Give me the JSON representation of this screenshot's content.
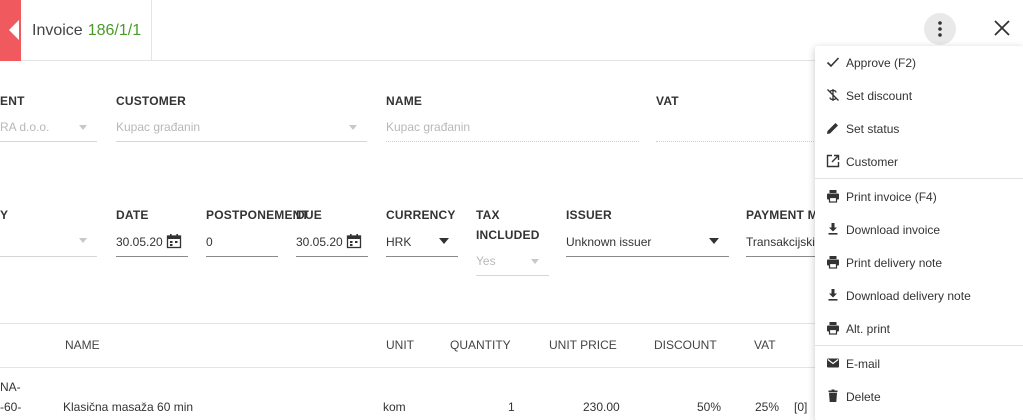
{
  "header": {
    "title_prefix": "Invoice",
    "title_number": "186/1/1"
  },
  "row1": {
    "partial_label": "ENT",
    "partial_value": "RA d.o.o.",
    "customer_label": "CUSTOMER",
    "customer_value": "Kupac građanin",
    "name_label": "NAME",
    "name_value": "Kupac građanin",
    "vat_label": "VAT"
  },
  "row2": {
    "partial_label": "Y",
    "date_label": "DATE",
    "date_value": "30.05.20",
    "postponement_label": "POSTPONEMENT",
    "postponement_value": "0",
    "due_label": "DUE",
    "due_value": "30.05.20",
    "currency_label": "CURRENCY",
    "currency_value": "HRK",
    "tax_label_1": "TAX",
    "tax_label_2": "INCLUDED",
    "tax_value": "Yes",
    "issuer_label": "ISSUER",
    "issuer_value": "Unknown issuer",
    "payment_label": "PAYMENT M",
    "payment_value": "Transakcijski"
  },
  "table": {
    "headers": {
      "name": "NAME",
      "unit": "UNIT",
      "quantity": "QUANTITY",
      "unit_price": "UNIT PRICE",
      "discount": "DISCOUNT",
      "vat": "VAT"
    },
    "row": {
      "code_line1": "NA-",
      "code_line2": "-60-",
      "name": "Klasična masaža 60 min",
      "unit": "kom",
      "quantity": "1",
      "unit_price": "230.00",
      "discount": "50%",
      "vat": "25%",
      "extra": "[0]"
    }
  },
  "menu": {
    "items": [
      {
        "label": "Approve (F2)",
        "icon": "check-icon"
      },
      {
        "label": "Set discount",
        "icon": "discount-off-icon"
      },
      {
        "label": "Set status",
        "icon": "pencil-icon"
      },
      {
        "label": "Customer",
        "icon": "open-external-icon"
      },
      {
        "label": "Print invoice (F4)",
        "icon": "printer-icon"
      },
      {
        "label": "Download invoice",
        "icon": "download-icon"
      },
      {
        "label": "Print delivery note",
        "icon": "printer-icon"
      },
      {
        "label": "Download delivery note",
        "icon": "download-icon"
      },
      {
        "label": "Alt. print",
        "icon": "printer-icon"
      },
      {
        "label": "E-mail",
        "icon": "mail-icon"
      },
      {
        "label": "Delete",
        "icon": "trash-icon"
      }
    ]
  },
  "colors": {
    "accent_red": "#f05a5f",
    "number_green": "#4a9b2a"
  }
}
